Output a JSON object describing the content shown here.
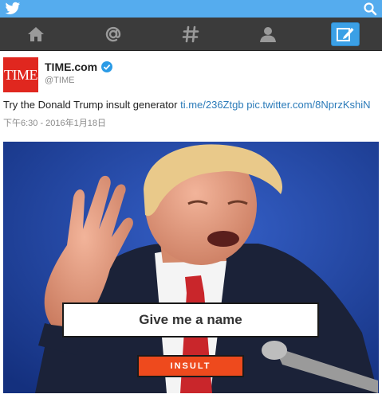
{
  "topbar": {
    "logo_icon": "twitter-bird-icon",
    "search_icon": "search-icon",
    "color": "#55acee"
  },
  "nav": {
    "items": [
      {
        "icon": "home-icon"
      },
      {
        "icon": "at-sign-icon"
      },
      {
        "icon": "hashtag-icon"
      },
      {
        "icon": "profile-icon"
      },
      {
        "icon": "compose-icon",
        "active": true
      }
    ],
    "background": "#3b3b3b",
    "active_color": "#3ba0e6"
  },
  "tweet": {
    "avatar_text": "TIME",
    "avatar_color": "#e0271f",
    "display_name": "TIME.com",
    "verified_icon": "verified-badge-icon",
    "handle": "@TIME",
    "text": "Try the Donald Trump insult generator ",
    "link1": "ti.me/236Ztgb",
    "link2": "pic.twitter.com/8NprzKshiN",
    "timestamp": "下午6:30 - 2016年1月18日",
    "media": {
      "input_text": "Give me a name",
      "button_label": "INSULT",
      "button_color": "#ee4a1d"
    }
  }
}
